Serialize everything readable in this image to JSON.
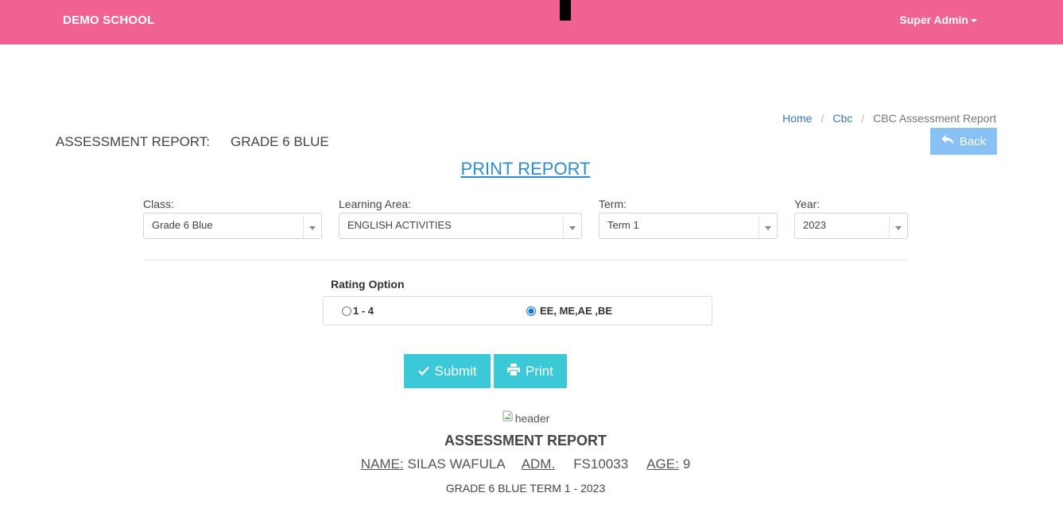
{
  "navbar": {
    "brand": "DEMO SCHOOL",
    "user_menu": "Super Admin"
  },
  "breadcrumb": {
    "items": [
      "Home",
      "Cbc",
      "CBC Assessment Report"
    ],
    "separator": "/"
  },
  "page_header": {
    "label": "ASSESSMENT REPORT:",
    "class_name": "GRADE 6 BLUE"
  },
  "back_button": {
    "label": "Back",
    "icon": "reply-icon"
  },
  "print_report_link": "PRINT REPORT",
  "filters": {
    "class": {
      "label": "Class:",
      "value": "Grade 6 Blue"
    },
    "learning_area": {
      "label": "Learning Area:",
      "value": "ENGLISH ACTIVITIES"
    },
    "term": {
      "label": "Term:",
      "value": "Term 1"
    },
    "year": {
      "label": "Year:",
      "value": "2023"
    }
  },
  "rating": {
    "label": "Rating Option",
    "options": [
      {
        "label": "1 - 4",
        "checked": false
      },
      {
        "label": "EE, ME,AE ,BE",
        "checked": true
      }
    ]
  },
  "actions": {
    "submit": {
      "label": "Submit",
      "icon": "check-icon"
    },
    "print": {
      "label": "Print",
      "icon": "print-icon"
    }
  },
  "report": {
    "header_image_alt": "header",
    "title": "ASSESSMENT REPORT",
    "name_label": "NAME:",
    "name": "SILAS WAFULA",
    "adm_label": "ADM.",
    "adm": "FS10033",
    "age_label": "AGE:",
    "age": "9",
    "subtitle": "GRADE 6 BLUE TERM 1 - 2023"
  },
  "colors": {
    "navbar": "#f06292",
    "link": "#337ab7",
    "print_link": "#2e8bd6",
    "back_button": "#87c1f5",
    "action_button": "#3bc8d7",
    "radio_accent": "#1a73e8"
  }
}
